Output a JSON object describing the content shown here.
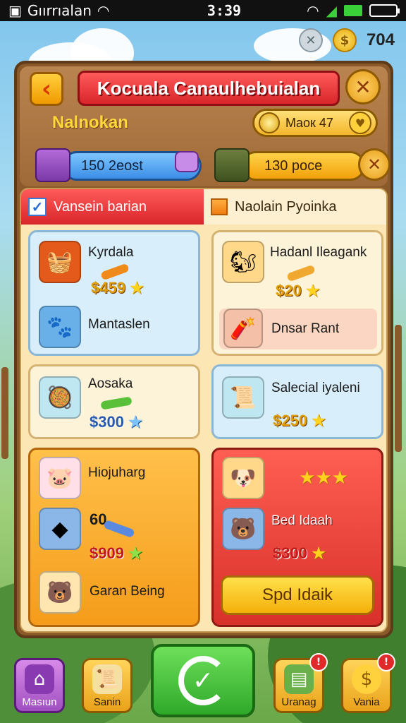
{
  "statusbar": {
    "carrier": "Gıırrıalan",
    "time": "3:39",
    "icons": [
      "wifi-icon",
      "signal-icon",
      "battery-icon"
    ]
  },
  "topbar": {
    "coin_count": "704",
    "settings_icon": "close-icon"
  },
  "header": {
    "title": "Kocuala Canaulhebuialan",
    "subtitle": "Nalnokan",
    "mask_label": "Maoк 47",
    "left_resource": "150 2eost",
    "right_resource": "130 poce"
  },
  "tabs": [
    {
      "label": "Vansein barian",
      "active": true
    },
    {
      "label": "Naolain Pyoinka",
      "active": false
    }
  ],
  "cards": {
    "card1": {
      "title": "Kyrdala",
      "price": "$459",
      "text2": "Mantaslen"
    },
    "card2": {
      "title": "Hadanl Ileagank",
      "price": "$20",
      "text2": "Dnsar Rant"
    },
    "card3": {
      "title": "Aosaka",
      "price": "$300"
    },
    "card4": {
      "title": "Salecial iyaleni",
      "price": "$250"
    },
    "card5": {
      "title": "Hiojuharg",
      "badge": "60",
      "price": "$909",
      "text2": "Garan Being"
    },
    "card6": {
      "title": "Bed Idaah",
      "price": "$300",
      "button": "Spd Idaik"
    }
  },
  "bottom_nav": [
    {
      "label": "Masıun",
      "icon": "house-icon"
    },
    {
      "label": "Sanin",
      "icon": "scroll-icon"
    },
    {
      "label": "Uranag",
      "icon": "cash-icon"
    },
    {
      "label": "Vania",
      "icon": "coin-icon"
    }
  ],
  "colors": {
    "primary_red": "#d8262a",
    "gold": "#f4b00a",
    "green": "#2fa82a",
    "panel_wood": "#8b5a2b"
  }
}
